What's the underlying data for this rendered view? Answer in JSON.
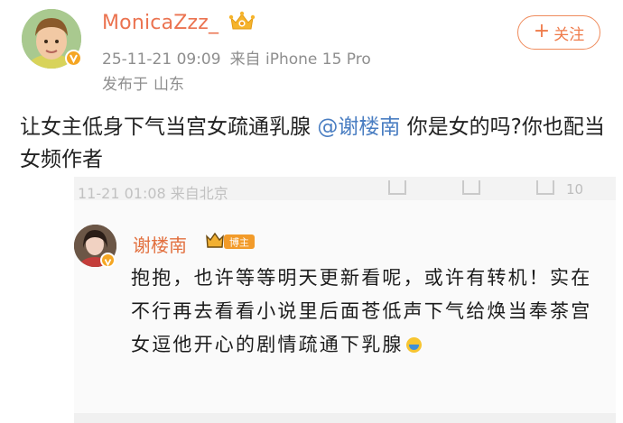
{
  "post": {
    "author": "MonicaZzz_",
    "date": "25-11-21 09:09",
    "source": "来自 iPhone 15 Pro",
    "location_prefix": "发布于",
    "location": "山东",
    "follow_label": "关注",
    "text_before": "让女主低身下气当宫女疏通乳腺 ",
    "mention": "@谢楼南",
    "text_after": " 你是女的吗?你也配当女频作者"
  },
  "embedded_comment": {
    "name": "谢楼南",
    "badge_label": "博主",
    "text": "抱抱，也许等等明天更新看呢，或许有转机！实在不行再去看看小说里后面苍低声下气给焕当奉茶宫女逗他开心的剧情疏通下乳腺",
    "cut_off_header": "11-21 01:08 来自北京",
    "cut_off_count": "10"
  },
  "colors": {
    "username": "#eb7350",
    "mention": "#4a7ec2",
    "follow_button": "#ef8b5c",
    "verified_badge": "#f5a623",
    "meta_text": "#8e8e8e"
  },
  "icons": [
    "verified-badge-icon",
    "crown-badge-icon",
    "plus-icon",
    "emoji-icon"
  ]
}
